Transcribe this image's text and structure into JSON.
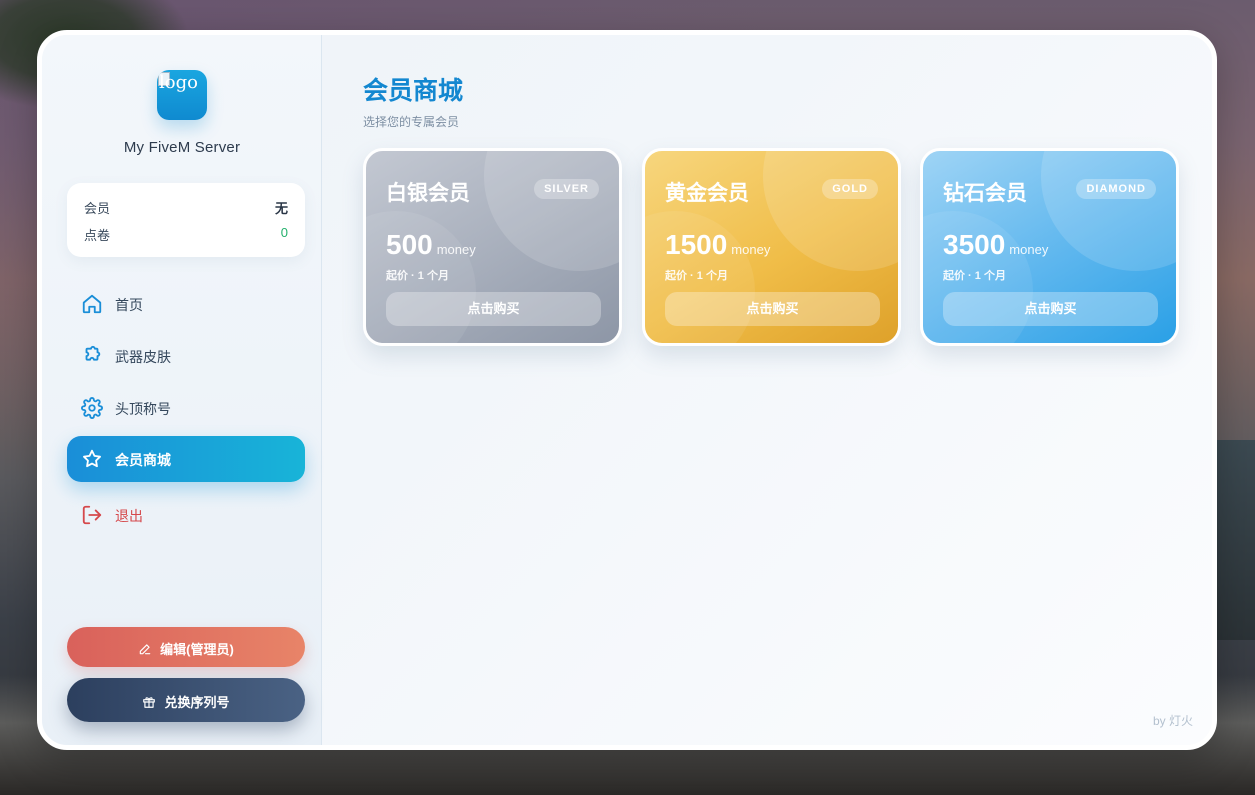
{
  "sidebar": {
    "logo_alt": "logo",
    "server_name": "My FiveM Server",
    "info": {
      "membership_label": "会员",
      "membership_value": "无",
      "points_label": "点卷",
      "points_value": "0"
    },
    "nav": [
      {
        "label": "首页",
        "icon": "home-icon"
      },
      {
        "label": "武器皮肤",
        "icon": "puzzle-icon"
      },
      {
        "label": "头顶称号",
        "icon": "gear-icon"
      },
      {
        "label": "会员商城",
        "icon": "star-icon",
        "active": true
      },
      {
        "label": "退出",
        "icon": "logout-icon"
      }
    ],
    "edit_button": "编辑(管理员)",
    "redeem_button": "兑换序列号"
  },
  "main": {
    "title": "会员商城",
    "subtitle": "选择您的专属会员",
    "cards": [
      {
        "name": "白银会员",
        "badge": "SILVER",
        "price": "500",
        "unit": "money",
        "period": "起价 · 1 个月",
        "buy": "点击购买"
      },
      {
        "name": "黄金会员",
        "badge": "GOLD",
        "price": "1500",
        "unit": "money",
        "period": "起价 · 1 个月",
        "buy": "点击购买"
      },
      {
        "name": "钻石会员",
        "badge": "DIAMOND",
        "price": "3500",
        "unit": "money",
        "period": "起价 · 1 个月",
        "buy": "点击购买"
      }
    ],
    "credit": "by 灯火"
  },
  "colors": {
    "accent": "#1387d0",
    "active_nav": "#1a8ed8",
    "logout": "#d5484b",
    "edit_button": "#d9615b",
    "redeem_button": "#2c3f5e",
    "points_value": "#22b06b"
  }
}
